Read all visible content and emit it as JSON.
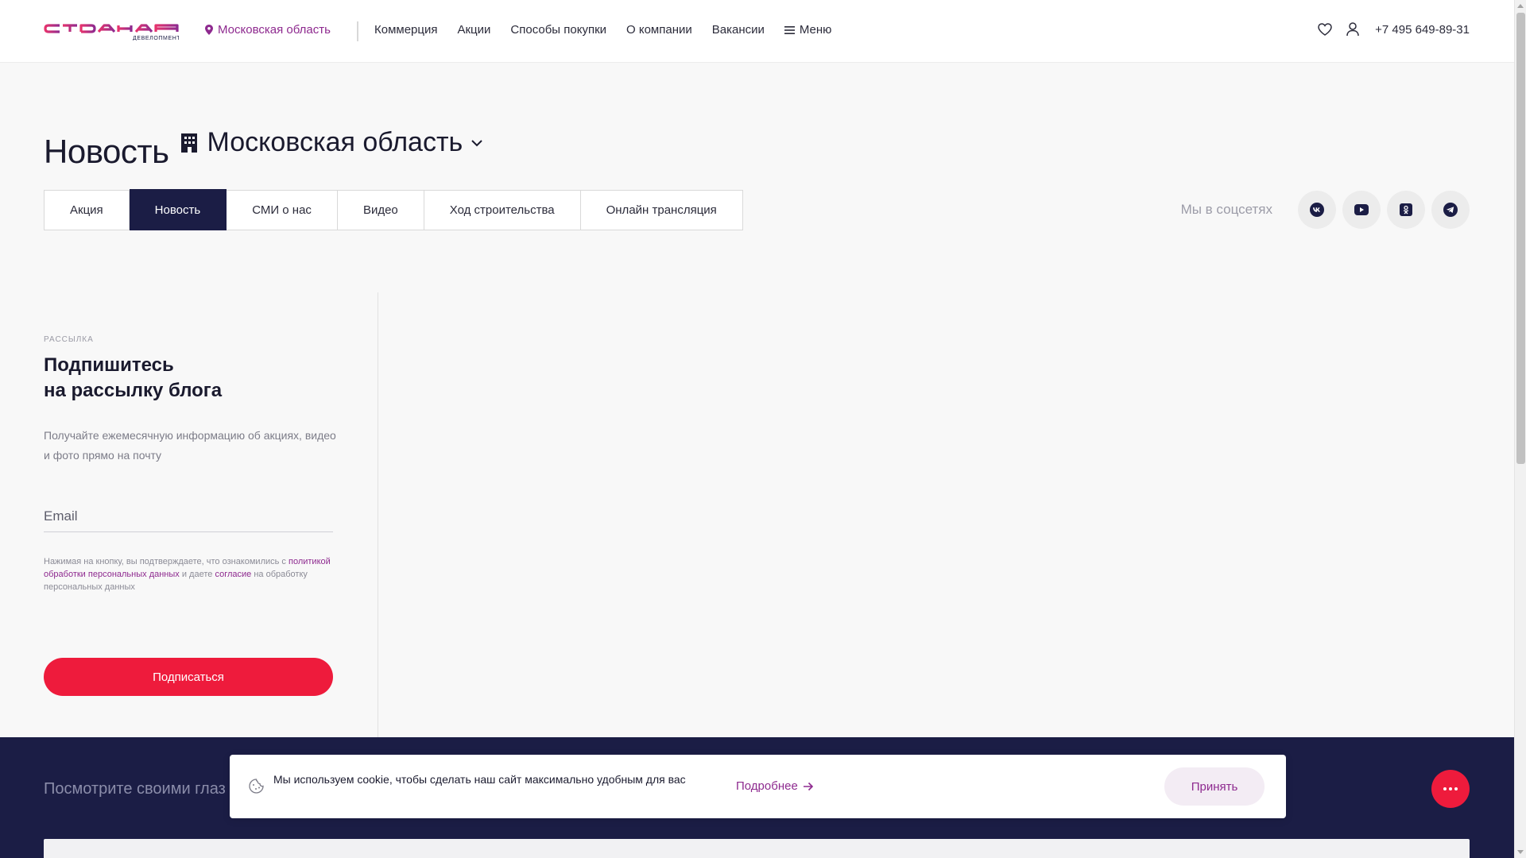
{
  "header": {
    "logo_alt": "страна девелопмент",
    "region": "Московская область",
    "nav": [
      "Коммерция",
      "Акции",
      "Способы покупки",
      "О компании",
      "Вакансии"
    ],
    "menu_label": "Меню",
    "phone": "+7 495 649-89-31"
  },
  "page": {
    "title": "Новость",
    "region": "Московская область"
  },
  "tabs": [
    {
      "label": "Акция",
      "active": false
    },
    {
      "label": "Новость",
      "active": true
    },
    {
      "label": "СМИ о нас",
      "active": false
    },
    {
      "label": "Видео",
      "active": false
    },
    {
      "label": "Ход строительства",
      "active": false
    },
    {
      "label": "Онлайн трансляция",
      "active": false
    }
  ],
  "social": {
    "label": "Мы в соцсетях",
    "icons": [
      "vk-icon",
      "youtube-icon",
      "odnoklassniki-icon",
      "telegram-icon"
    ]
  },
  "subscribe": {
    "kicker": "РАССЫЛКА",
    "title_line1": "Подпишитесь",
    "title_line2": "на рассылку блога",
    "description": "Получайте ежемесячную информацию об акциях, видео и фото прямо на почту",
    "email_placeholder": "Email",
    "legal_prefix": "Нажимая на кнопку, вы подтверждаете, что ознакомились с",
    "legal_link1": "политикой обработки персональных данных",
    "legal_mid": "и даете",
    "legal_link2": "согласие",
    "legal_suffix": "на обработку персональных данных",
    "button": "Подписаться"
  },
  "dark_section": {
    "title": "Посмотрите своими глаз"
  },
  "cookie": {
    "text": "Мы используем cookie, чтобы сделать наш сайт максимально удобным для вас",
    "more": "Подробнее",
    "accept": "Принять"
  },
  "colors": {
    "brand_purple": "#8e2a8f",
    "brand_red": "#ee1b3c",
    "navy": "#1b1d45"
  }
}
